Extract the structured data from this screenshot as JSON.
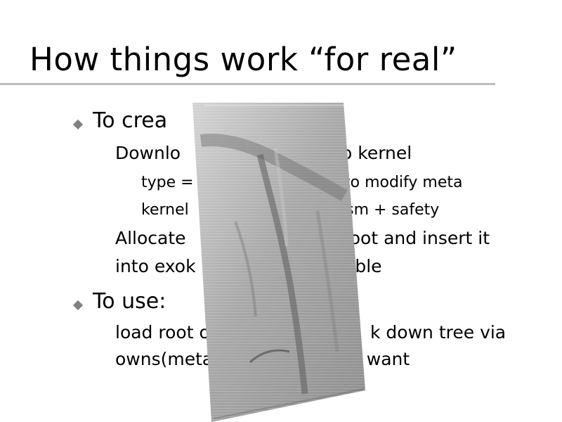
{
  "slide": {
    "title": "How things work “for real”",
    "lines": [
      "To crea",
      "Downlo",
      "o kernel",
      "type =",
      "to modify meta",
      "kernel",
      "ism + safety",
      "Allocate",
      "root and insert it",
      "into exok",
      "able",
      "To use:",
      "load root o",
      "k down tree via",
      "owns(meta)",
      "u want"
    ]
  }
}
